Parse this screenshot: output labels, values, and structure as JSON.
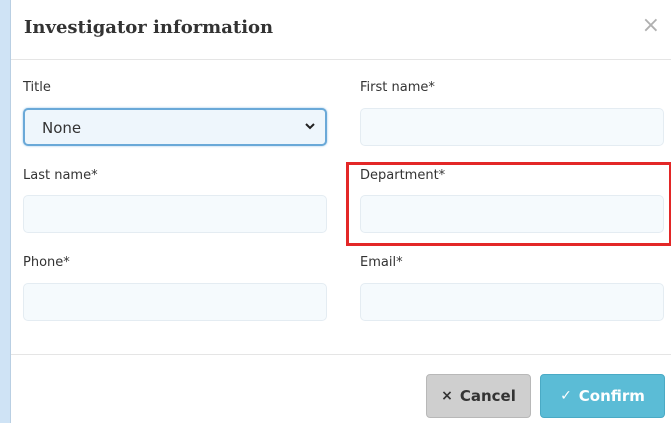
{
  "dialog": {
    "title": "Investigator information",
    "close_glyph": "×"
  },
  "form": {
    "title_label": "Title",
    "title_value": "None",
    "first_name_label": "First name*",
    "first_name_value": "",
    "last_name_label": "Last name*",
    "last_name_value": "",
    "department_label": "Department*",
    "department_value": "",
    "phone_label": "Phone*",
    "phone_value": "",
    "email_label": "Email*",
    "email_value": ""
  },
  "footer": {
    "cancel_label": "Cancel",
    "cancel_icon": "×",
    "confirm_label": "Confirm",
    "confirm_icon": "✓"
  },
  "colors": {
    "backdrop": "#cfe3f5",
    "highlight": "#e32727",
    "confirm_button": "#5bbcd6",
    "cancel_button": "#cfcfcf"
  }
}
